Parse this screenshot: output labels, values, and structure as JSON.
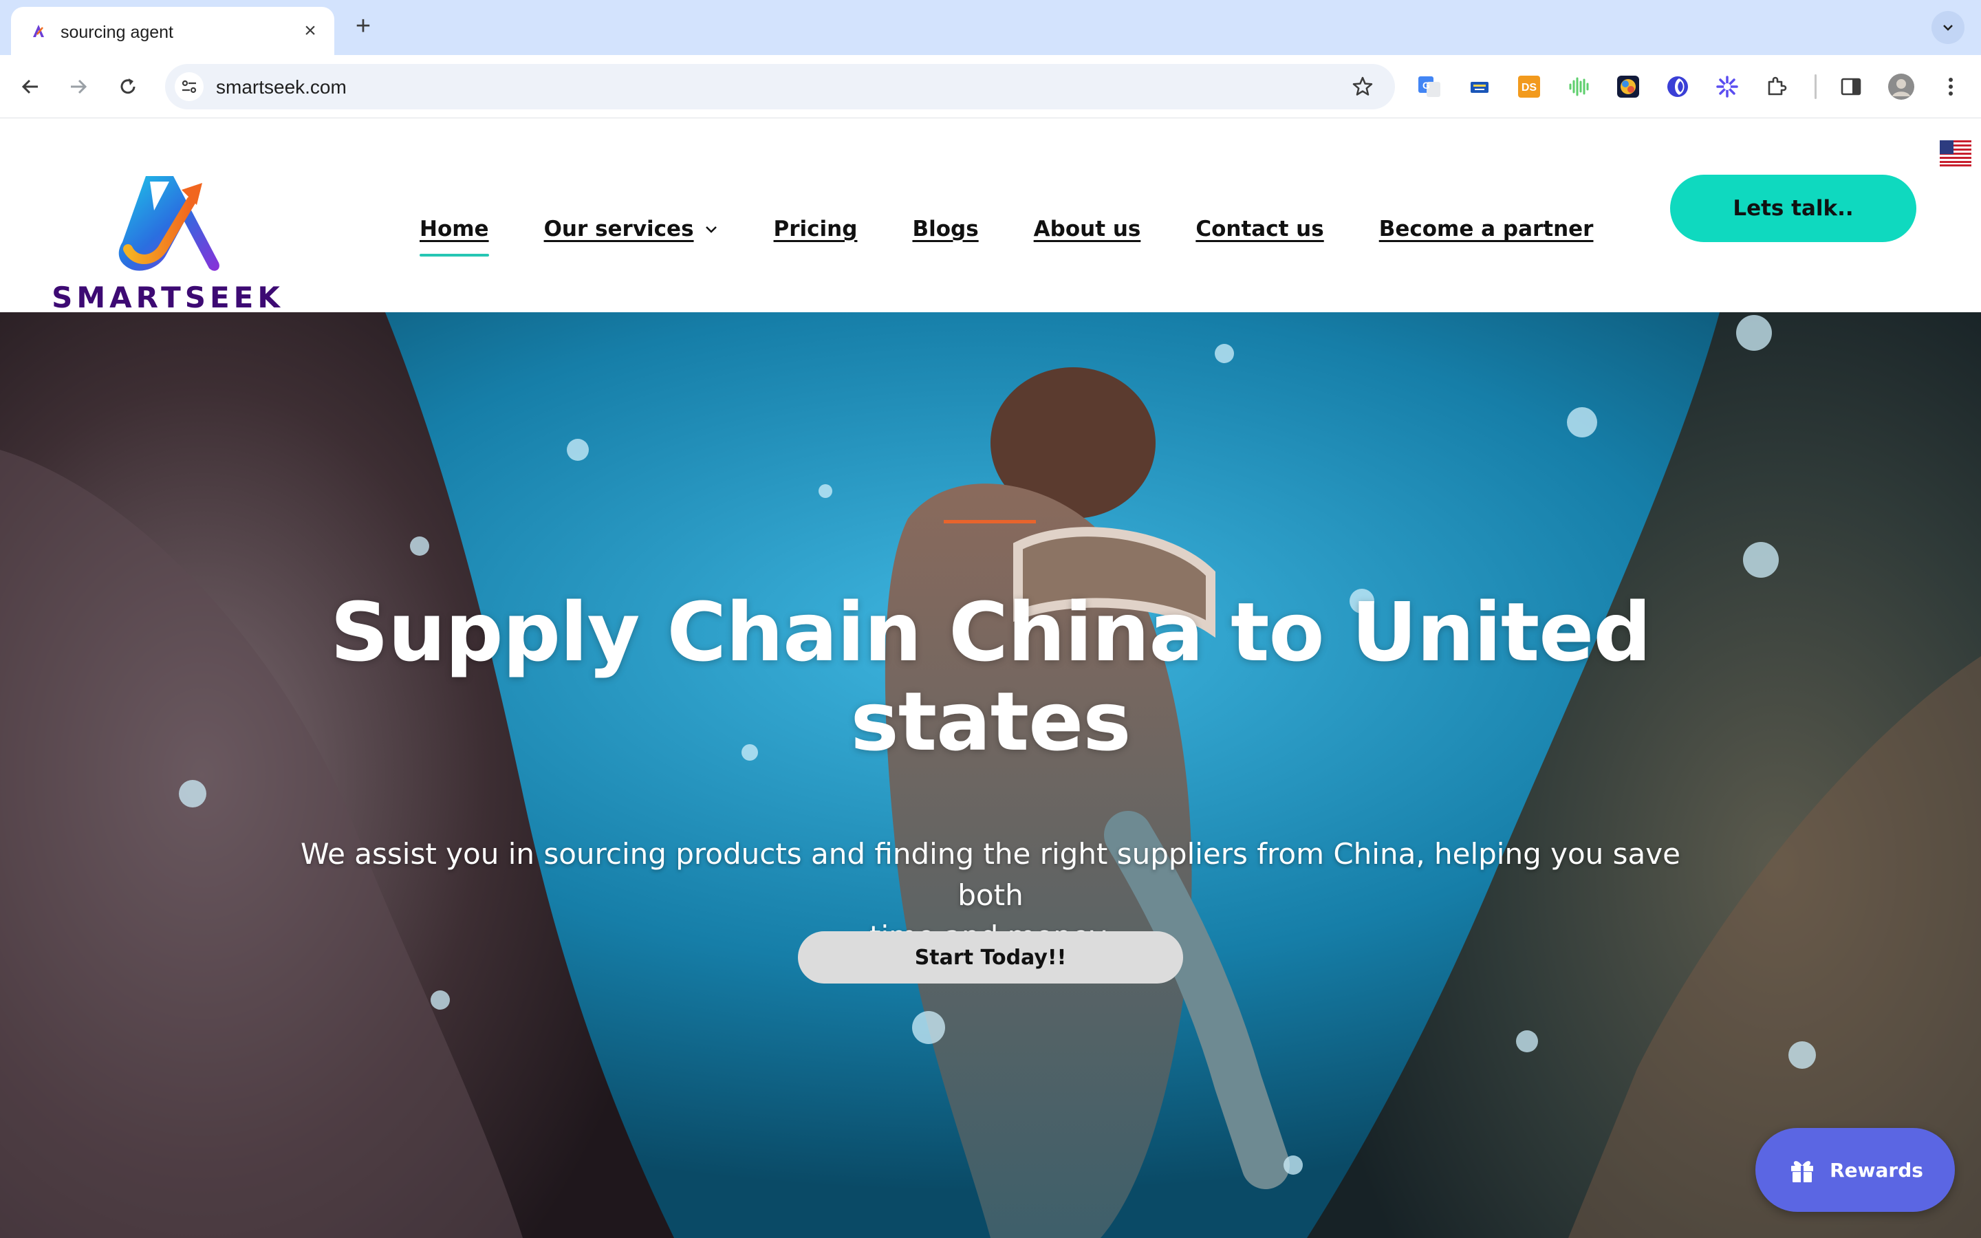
{
  "browser": {
    "tab_title": "sourcing agent",
    "url": "smartseek.com",
    "extensions": [
      "google-translate-icon",
      "keyboard-icon",
      "ds-icon",
      "audio-wave-icon",
      "colorful-extension-icon",
      "blue-moon-icon",
      "sparkle-icon",
      "puzzle-icon"
    ],
    "ds_label": "DS"
  },
  "site": {
    "logo_text": "SMARTSEEK",
    "nav": [
      {
        "label": "Home",
        "active": true
      },
      {
        "label": "Our services",
        "has_dropdown": true
      },
      {
        "label": "Pricing"
      },
      {
        "label": "Blogs"
      },
      {
        "label": "About us"
      },
      {
        "label": "Contact us"
      },
      {
        "label": "Become a partner"
      }
    ],
    "cta_label": "Lets talk..",
    "accent_color": "#0fd9bf"
  },
  "hero": {
    "title_line1": "Supply Chain China to United",
    "title_line2": "states",
    "subtitle_line1": "We assist you in sourcing products and finding the right suppliers from China, helping you save both",
    "subtitle_line2": "time and money.",
    "button_label": "Start Today!!",
    "accent_line_color": "#e8642c"
  },
  "widget": {
    "rewards_label": "Rewards",
    "color": "#5b66e3"
  }
}
